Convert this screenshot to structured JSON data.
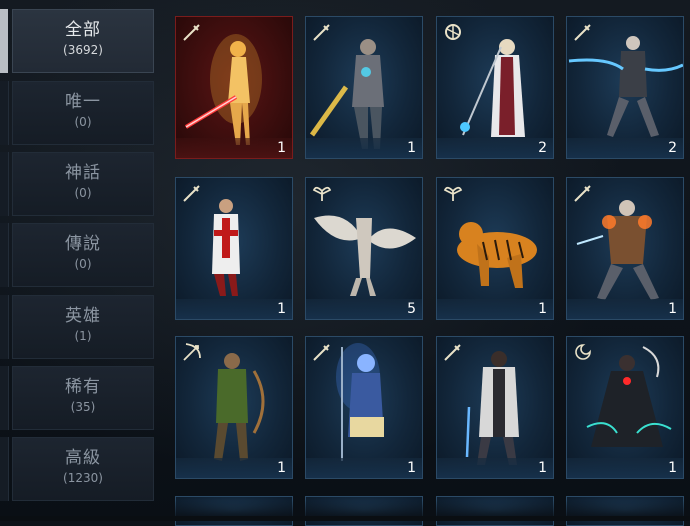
{
  "filter_tabs": [
    {
      "label": "全部",
      "count": "(3692)",
      "active": true
    },
    {
      "label": "唯一",
      "count": "(0)",
      "active": false
    },
    {
      "label": "神話",
      "count": "(0)",
      "active": false
    },
    {
      "label": "傳說",
      "count": "(0)",
      "active": false
    },
    {
      "label": "英雄",
      "count": "(1)",
      "active": false
    },
    {
      "label": "稀有",
      "count": "(35)",
      "active": false
    },
    {
      "label": "高級",
      "count": "(1230)",
      "active": false
    }
  ],
  "cards": [
    {
      "count": "1",
      "class_icon": "sword-class-icon",
      "tier_color": "#7a1c1c"
    },
    {
      "count": "1",
      "class_icon": "sword-class-icon",
      "tier_color": "#2b4a66"
    },
    {
      "count": "2",
      "class_icon": "staff-class-icon",
      "tier_color": "#2b4a66"
    },
    {
      "count": "2",
      "class_icon": "sword-class-icon",
      "tier_color": "#2b4a66"
    },
    {
      "count": "1",
      "class_icon": "sword-class-icon",
      "tier_color": "#2b4a66"
    },
    {
      "count": "5",
      "class_icon": "wing-class-icon",
      "tier_color": "#2b4a66"
    },
    {
      "count": "1",
      "class_icon": "wing-class-icon",
      "tier_color": "#2b4a66"
    },
    {
      "count": "1",
      "class_icon": "sword-class-icon",
      "tier_color": "#2b4a66"
    },
    {
      "count": "1",
      "class_icon": "bow-class-icon",
      "tier_color": "#2b4a66"
    },
    {
      "count": "1",
      "class_icon": "sword-class-icon",
      "tier_color": "#2b4a66"
    },
    {
      "count": "1",
      "class_icon": "sword-class-icon",
      "tier_color": "#2b4a66"
    },
    {
      "count": "1",
      "class_icon": "crescent-class-icon",
      "tier_color": "#2b4a66"
    }
  ]
}
